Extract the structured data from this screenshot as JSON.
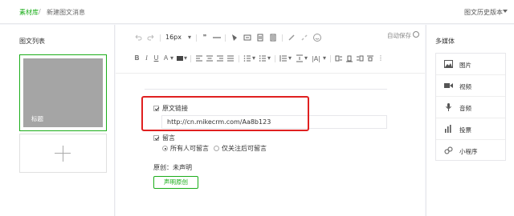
{
  "breadcrumb": {
    "root": "素材库",
    "separator": "/",
    "current": "新建图文消息"
  },
  "header": {
    "history_label": "图文历史版本"
  },
  "left": {
    "title": "图文列表",
    "cover_title": "标题",
    "add_symbol": "+"
  },
  "toolbar": {
    "font_size": "16px",
    "autosave": "自动保存",
    "row1_icons": [
      "undo-icon",
      "redo-icon",
      "quote-icon",
      "hr-icon",
      "paint-format-icon",
      "clear-format-icon",
      "template-icon",
      "code-icon",
      "link-icon",
      "unlink-icon",
      "emotion-icon"
    ],
    "row2_icons": [
      "bold-icon",
      "italic-icon",
      "underline-icon",
      "font-color-icon",
      "bg-color-icon",
      "align-left-icon",
      "align-center-icon",
      "align-right-icon",
      "align-justify-icon",
      "ordered-list-icon",
      "unordered-list-icon",
      "line-height-icon",
      "indent-icon",
      "letter-spacing-icon"
    ]
  },
  "form": {
    "original_link_label": "原文链接",
    "original_link_value": "http://cn.mikecrm.com/Aa8b123",
    "comment_label": "留言",
    "comment_option_all": "所有人可留言",
    "comment_option_followers": "仅关注后可留言",
    "original_status": "原创：未声明",
    "declare_button": "声明原创"
  },
  "right": {
    "title": "多媒体",
    "items": [
      {
        "label": "图片",
        "icon": "image-icon"
      },
      {
        "label": "视频",
        "icon": "video-icon"
      },
      {
        "label": "音频",
        "icon": "microphone-icon"
      },
      {
        "label": "投票",
        "icon": "poll-icon"
      },
      {
        "label": "小程序",
        "icon": "mini-program-icon"
      }
    ]
  },
  "colors": {
    "accent": "#1aad19",
    "highlight": "#e02020",
    "cover": "#a5a5a5"
  }
}
